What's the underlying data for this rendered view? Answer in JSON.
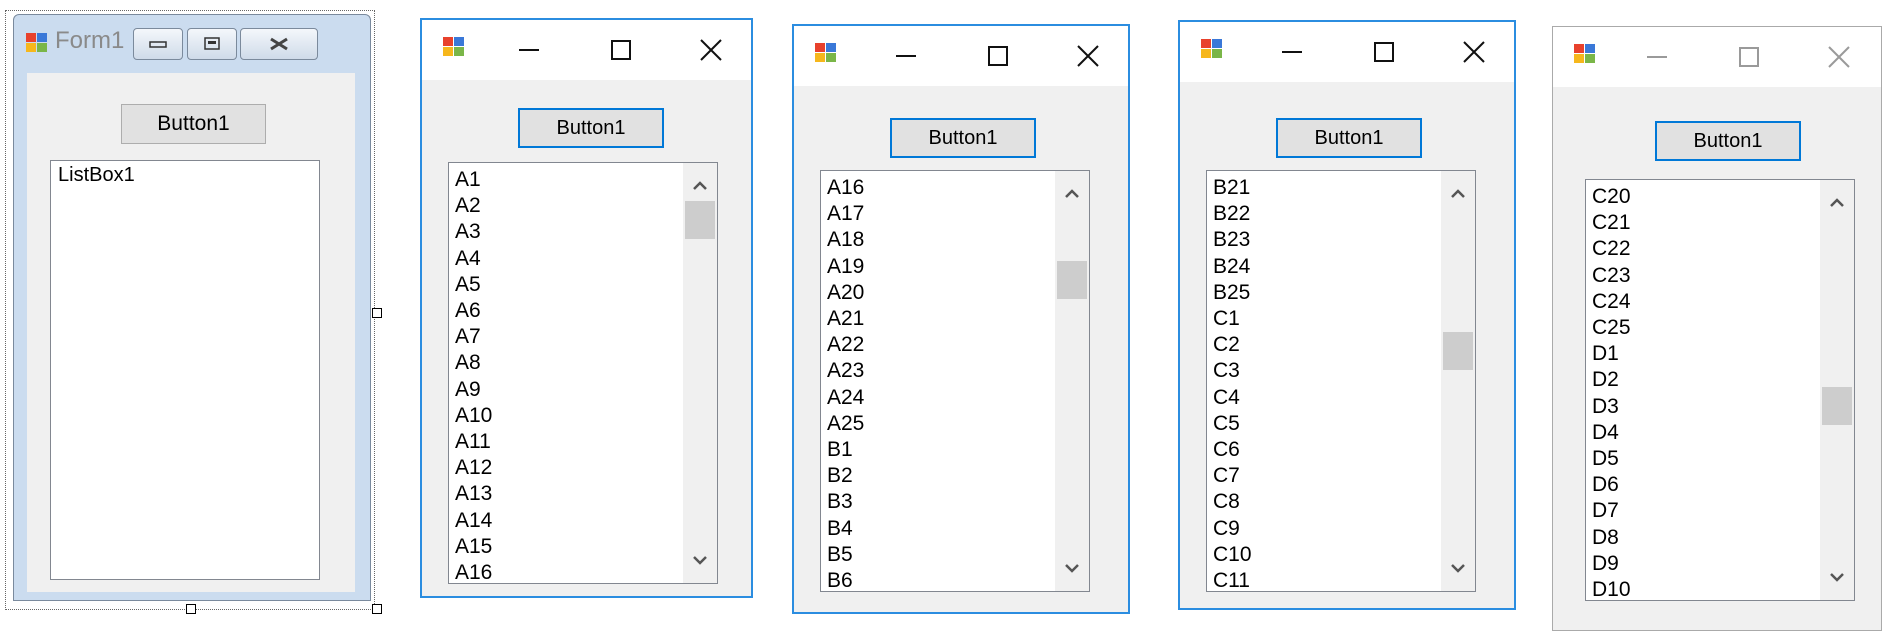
{
  "designer": {
    "title": "Form1",
    "button_label": "Button1",
    "listbox_label": "ListBox1"
  },
  "windows": [
    {
      "button_label": "Button1",
      "items": [
        "A1",
        "A2",
        "A3",
        "A4",
        "A5",
        "A6",
        "A7",
        "A8",
        "A9",
        "A10",
        "A11",
        "A12",
        "A13",
        "A14",
        "A15",
        "A16"
      ],
      "scroll_fraction": 0.0
    },
    {
      "button_label": "Button1",
      "items": [
        "A16",
        "A17",
        "A18",
        "A19",
        "A20",
        "A21",
        "A22",
        "A23",
        "A24",
        "A25",
        "B1",
        "B2",
        "B3",
        "B4",
        "B5",
        "B6"
      ],
      "scroll_fraction": 0.17
    },
    {
      "button_label": "Button1",
      "items": [
        "B21",
        "B22",
        "B23",
        "B24",
        "B25",
        "C1",
        "C2",
        "C3",
        "C4",
        "C5",
        "C6",
        "C7",
        "C8",
        "C9",
        "C10",
        "C11"
      ],
      "scroll_fraction": 0.4
    },
    {
      "button_label": "Button1",
      "items": [
        "C20",
        "C21",
        "C22",
        "C23",
        "C24",
        "C25",
        "D1",
        "D2",
        "D3",
        "D4",
        "D5",
        "D6",
        "D7",
        "D8",
        "D9",
        "D10"
      ],
      "scroll_fraction": 0.55
    }
  ],
  "icons": {
    "app": "winforms-app-icon",
    "minimize": "minimize-icon",
    "maximize": "maximize-icon",
    "close": "close-icon",
    "scroll_up": "chevron-up-icon",
    "scroll_down": "chevron-down-icon"
  },
  "colors": {
    "active_border": "#2b8de0",
    "focus_button_border": "#0078d7",
    "client_background": "#f0f0f0"
  }
}
